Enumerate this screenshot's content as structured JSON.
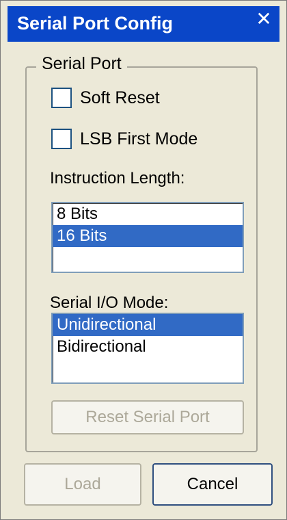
{
  "window": {
    "title": "Serial Port Config",
    "close_glyph": "✕"
  },
  "group": {
    "label": "Serial Port",
    "soft_reset": {
      "label": "Soft Reset",
      "checked": false
    },
    "lsb_first": {
      "label": "LSB First Mode",
      "checked": false
    },
    "instruction_length": {
      "label": "Instruction Length:",
      "options": [
        "8 Bits",
        "16 Bits"
      ],
      "selected": "16 Bits"
    },
    "serial_io_mode": {
      "label": "Serial I/O Mode:",
      "options": [
        "Unidirectional",
        "Bidirectional"
      ],
      "selected": "Unidirectional"
    },
    "reset_button": {
      "label": "Reset Serial Port",
      "enabled": false
    }
  },
  "buttons": {
    "load": {
      "label": "Load",
      "enabled": false
    },
    "cancel": {
      "label": "Cancel",
      "enabled": true
    }
  },
  "colors": {
    "titlebar": "#0a46c8",
    "window_bg": "#ece9d8",
    "selection": "#316ac5"
  }
}
